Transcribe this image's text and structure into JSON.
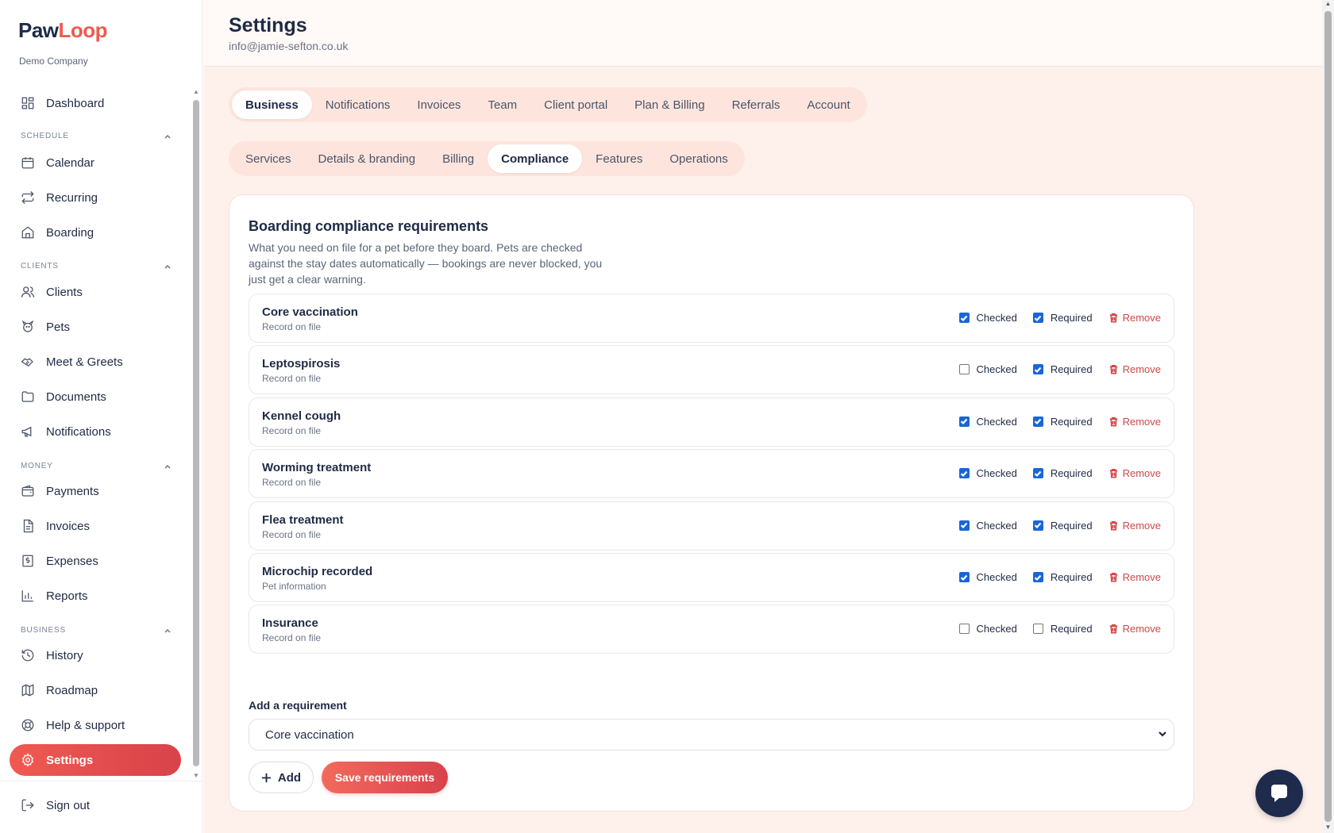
{
  "brand": {
    "logo_paw": "Paw",
    "logo_loop": "Loop",
    "company": "Demo Company",
    "accent": "#ef5a50"
  },
  "sidebar": {
    "dashboard": "Dashboard",
    "sections": {
      "schedule": "SCHEDULE",
      "clients": "CLIENTS",
      "money": "MONEY",
      "business": "BUSINESS"
    },
    "items": {
      "calendar": "Calendar",
      "recurring": "Recurring",
      "boarding": "Boarding",
      "clients": "Clients",
      "pets": "Pets",
      "meet_greets": "Meet & Greets",
      "documents": "Documents",
      "notifications": "Notifications",
      "payments": "Payments",
      "invoices": "Invoices",
      "expenses": "Expenses",
      "reports": "Reports",
      "history": "History",
      "roadmap": "Roadmap",
      "help": "Help & support",
      "settings": "Settings"
    },
    "sign_out": "Sign out"
  },
  "header": {
    "title": "Settings",
    "email": "info@jamie-sefton.co.uk"
  },
  "primary_tabs": [
    "Business",
    "Notifications",
    "Invoices",
    "Team",
    "Client portal",
    "Plan & Billing",
    "Referrals",
    "Account"
  ],
  "secondary_tabs": [
    "Services",
    "Details & branding",
    "Billing",
    "Compliance",
    "Features",
    "Operations"
  ],
  "card": {
    "title": "Boarding compliance requirements",
    "description": "What you need on file for a pet before they board. Pets are checked against the stay dates automatically — bookings are never blocked, you just get a clear warning.",
    "checked_label": "Checked",
    "required_label": "Required",
    "remove_label": "Remove",
    "requirements": [
      {
        "name": "Core vaccination",
        "source": "Record on file",
        "checked": true,
        "required": true
      },
      {
        "name": "Leptospirosis",
        "source": "Record on file",
        "checked": false,
        "required": true
      },
      {
        "name": "Kennel cough",
        "source": "Record on file",
        "checked": true,
        "required": true
      },
      {
        "name": "Worming treatment",
        "source": "Record on file",
        "checked": true,
        "required": true
      },
      {
        "name": "Flea treatment",
        "source": "Record on file",
        "checked": true,
        "required": true
      },
      {
        "name": "Microchip recorded",
        "source": "Pet information",
        "checked": true,
        "required": true
      },
      {
        "name": "Insurance",
        "source": "Record on file",
        "checked": false,
        "required": false
      }
    ],
    "add_label": "Add a requirement",
    "select_value": "Core vaccination",
    "add_button": "Add",
    "save_button": "Save requirements"
  }
}
